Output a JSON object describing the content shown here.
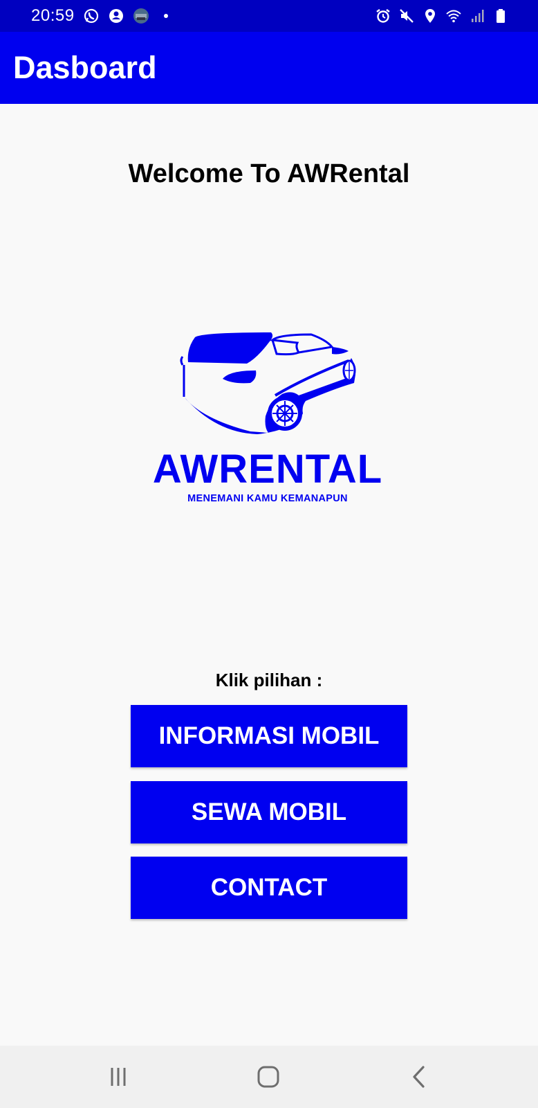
{
  "status_bar": {
    "time": "20:59",
    "icons": [
      "whatsapp-icon",
      "account-icon",
      "photo-icon",
      "dot-icon",
      "alarm-icon",
      "mute-icon",
      "location-icon",
      "wifi-icon",
      "signal-icon",
      "battery-icon"
    ]
  },
  "app_bar": {
    "title": "Dasboard"
  },
  "main": {
    "welcome": "Welcome To AWRental",
    "logo": {
      "name": "AWRENTAL",
      "tagline": "MENEMANI KAMU KEMANAPUN"
    },
    "prompt": "Klik pilihan :",
    "buttons": [
      "INFORMASI MOBIL",
      "SEWA MOBIL",
      "CONTACT"
    ]
  },
  "nav_bar": {
    "icons": [
      "recent-apps-icon",
      "home-icon",
      "back-icon"
    ]
  },
  "colors": {
    "status_bar": "#0000c0",
    "app_bar": "#0000ef",
    "button": "#0000f0",
    "logo": "#0000f0",
    "background": "#f9f9f9"
  }
}
